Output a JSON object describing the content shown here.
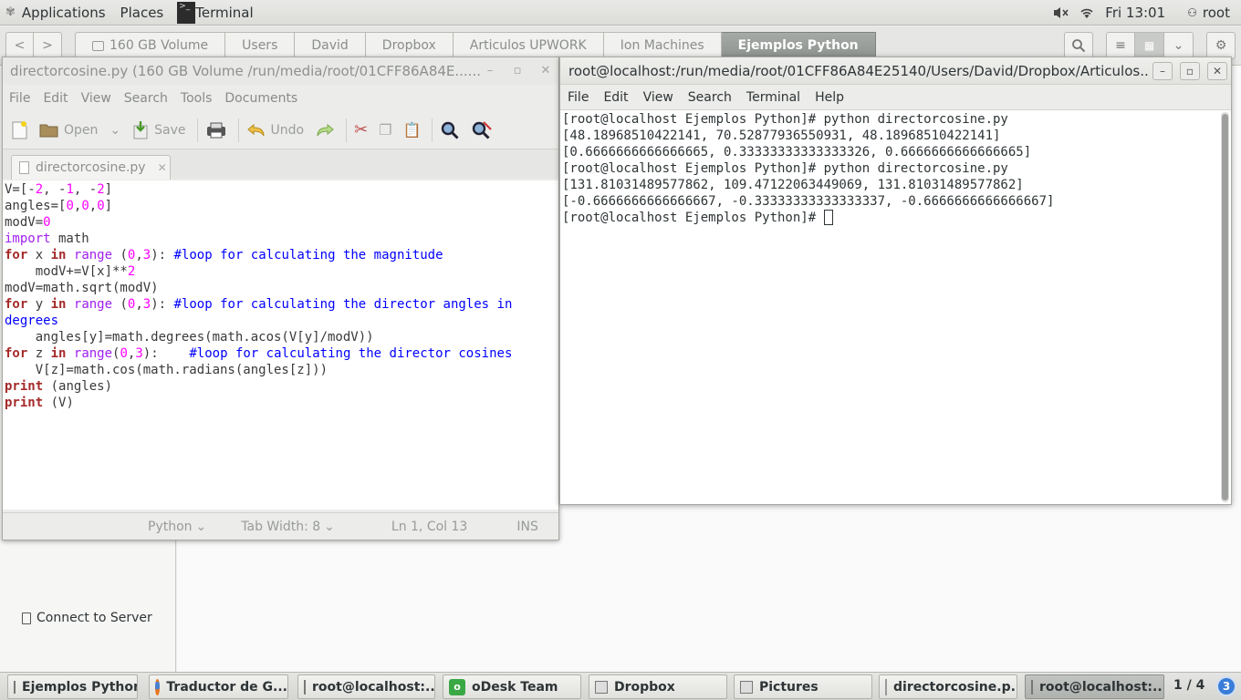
{
  "top_panel": {
    "applications": "Applications",
    "places": "Places",
    "active_app": "Terminal",
    "clock": "Fri 13:01",
    "user": "root"
  },
  "nautilus": {
    "breadcrumbs": [
      "160 GB Volume",
      "Users",
      "David",
      "Dropbox",
      "Articulos UPWORK",
      "Ion Machines",
      "Ejemplos Python"
    ],
    "sidebar_connect": "Connect to Server"
  },
  "gedit": {
    "title": "directorcosine.py (160 GB Volume /run/media/root/01CFF86A84E......",
    "menu": [
      "File",
      "Edit",
      "View",
      "Search",
      "Tools",
      "Documents"
    ],
    "toolbar": {
      "open": "Open",
      "save": "Save",
      "undo": "Undo"
    },
    "tab_label": "directorcosine.py",
    "status": {
      "language": "Python",
      "tab_width": "Tab Width:  8",
      "position": "Ln 1, Col 13",
      "mode": "INS"
    }
  },
  "terminal": {
    "title": "root@localhost:/run/media/root/01CFF86A84E25140/Users/David/Dropbox/Articulos...",
    "menu": [
      "File",
      "Edit",
      "View",
      "Search",
      "Terminal",
      "Help"
    ],
    "lines": [
      "[root@localhost Ejemplos Python]# python directorcosine.py",
      "[48.18968510422141, 70.52877936550931, 48.18968510422141]",
      "[0.6666666666666665, 0.33333333333333326, 0.6666666666666665]",
      "[root@localhost Ejemplos Python]# python directorcosine.py",
      "[131.81031489577862, 109.47122063449069, 131.81031489577862]",
      "[-0.6666666666666667, -0.33333333333333337, -0.6666666666666667]"
    ],
    "prompt": "[root@localhost Ejemplos Python]# "
  },
  "taskbar": {
    "tasks": [
      "Ejemplos Python",
      "Traductor de G...",
      "root@localhost:...",
      "oDesk Team",
      "Dropbox",
      "Pictures",
      "directorcosine.p...",
      "root@localhost:..."
    ],
    "workspace": "1 / 4",
    "notification_count": "3"
  }
}
